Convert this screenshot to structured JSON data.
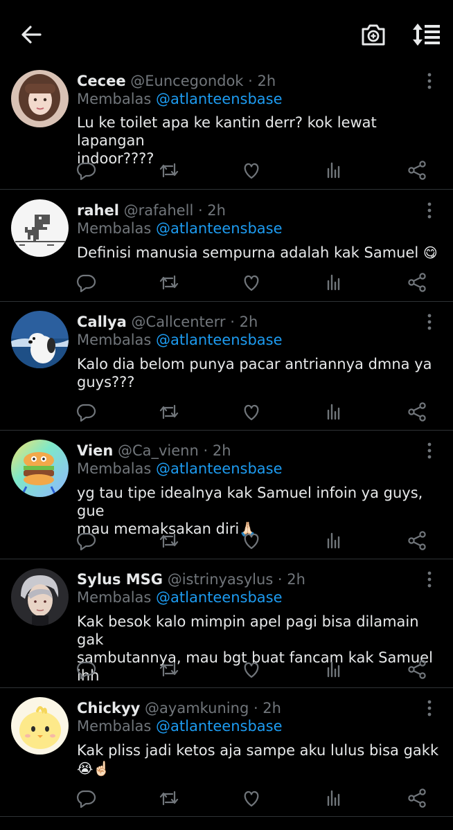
{
  "header": {
    "back_icon": "arrow-left-icon",
    "camera_icon": "camera-icon",
    "sort_icon": "sort-icon"
  },
  "reply_prefix": "Membalas",
  "colors": {
    "accent": "#1d9bf0",
    "muted": "#71767b",
    "text": "#e7e9ea",
    "divider": "#2f3336"
  },
  "tweets": [
    {
      "name": "Cecee",
      "handle": "@Euncegondok · 2h",
      "reply_to": "@atlanteensbase",
      "text_lines": [
        "Lu ke toilet apa ke kantin derr? kok lewat lapangan",
        "indoor????"
      ],
      "emoji": ""
    },
    {
      "name": "rahel",
      "handle": "@rafahell · 2h",
      "reply_to": "@atlanteensbase",
      "text_lines": [
        "Definisi manusia sempurna adalah kak Samuel "
      ],
      "emoji": "😋"
    },
    {
      "name": "Callya",
      "handle": "@Callcenterr · 2h",
      "reply_to": "@atlanteensbase",
      "text_lines": [
        "Kalo dia belom punya pacar antriannya dmna ya",
        "guys???"
      ],
      "emoji": ""
    },
    {
      "name": "Vien",
      "handle": "@Ca_vienn · 2h",
      "reply_to": "@atlanteensbase",
      "text_lines": [
        "yg tau tipe idealnya kak Samuel infoin ya guys, gue",
        "mau memaksakan diri"
      ],
      "emoji": "🙏🏻"
    },
    {
      "name": "Sylus MSG",
      "handle": "@istrinyasylus · 2h",
      "reply_to": "@atlanteensbase",
      "text_lines": [
        "Kak besok kalo mimpin apel pagi bisa dilamain gak",
        "sambutannya, mau bgt buat fancam kak Samuel ihh"
      ],
      "emoji": ""
    },
    {
      "name": "Chickyy",
      "handle": "@ayamkuning · 2h",
      "reply_to": "@atlanteensbase",
      "text_lines": [
        "Kak pliss jadi ketos aja sampe aku lulus bisa gakk",
        ""
      ],
      "emoji": "😭☝🏻"
    }
  ]
}
